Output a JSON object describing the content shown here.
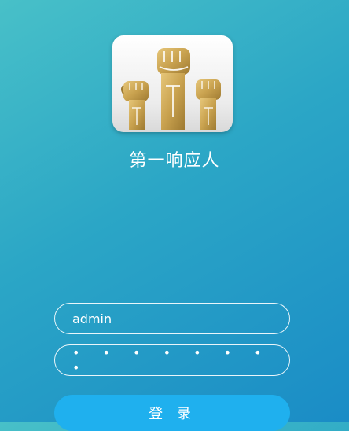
{
  "app": {
    "name": "第一响应人",
    "logo_icon": "raised-fists-icon"
  },
  "login_form": {
    "username_value": "admin",
    "password_masked": "• • • • • • • •",
    "login_label": "登 录"
  },
  "colors": {
    "background_start": "#48c0c8",
    "background_end": "#1a8cc6",
    "button": "#1fb0ee",
    "fist_gold": "#c9a24f"
  }
}
